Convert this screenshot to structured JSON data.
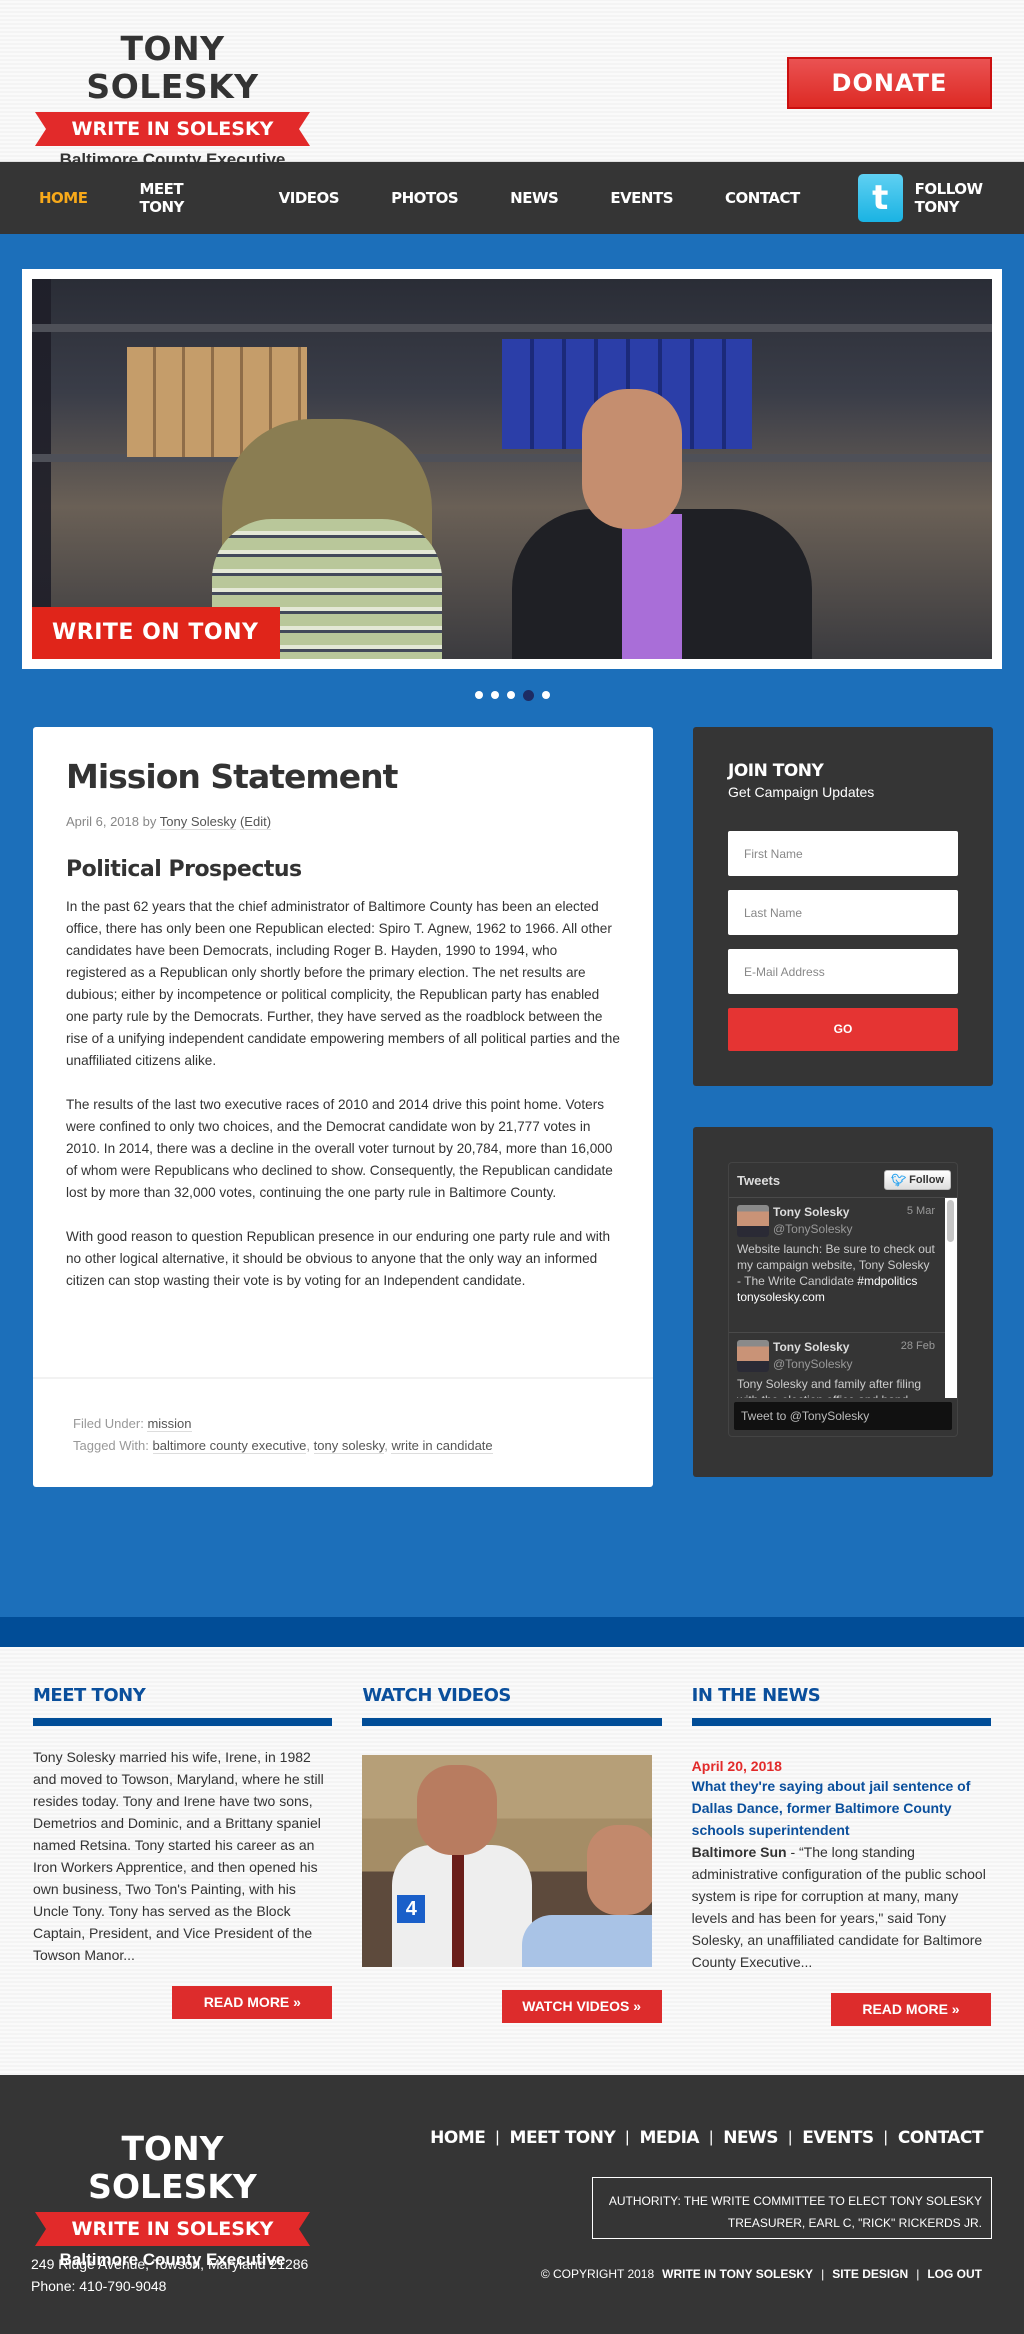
{
  "header": {
    "logo": {
      "name": "TONY SOLESKY",
      "ribbon": "WRITE IN SOLESKY",
      "subtitle": "Baltimore County Executive"
    },
    "donate_label": "DONATE"
  },
  "nav": {
    "items": [
      {
        "label": "HOME",
        "active": true
      },
      {
        "label": "MEET TONY"
      },
      {
        "label": "VIDEOS"
      },
      {
        "label": "PHOTOS"
      },
      {
        "label": "NEWS"
      },
      {
        "label": "EVENTS"
      },
      {
        "label": "CONTACT"
      }
    ],
    "follow_label": "FOLLOW TONY",
    "follow_icon": "twitter-icon"
  },
  "slider": {
    "caption": "WRITE ON TONY",
    "slide_count": 5,
    "active_slide": 4
  },
  "post": {
    "title": "Mission Statement",
    "date": "April 6, 2018",
    "by": "by",
    "author": "Tony Solesky",
    "edit_label": "(Edit)",
    "subheading": "Political Prospectus",
    "paragraphs": [
      "In the past 62 years that the chief administrator of Baltimore County has been an elected office, there has only been one Republican elected: Spiro T. Agnew, 1962 to 1966. All other candidates have been Democrats, including Roger B. Hayden, 1990 to 1994, who registered as a Republican only shortly before the primary election. The net results are dubious; either by incompetence or political complicity, the Republican party has enabled one party rule by the Democrats. Further, they have served as the roadblock between the rise of a unifying independent candidate empowering members of all political parties and the unaffiliated citizens alike.",
      "The results of the last two executive races of 2010 and 2014 drive this point home. Voters were confined to only two choices, and the Democrat candidate won by 21,777 votes in 2010. In 2014, there was a decline in the overall voter turnout by 20,784, more than 16,000 of whom were Republicans who declined to show. Consequently, the Republican candidate lost by more than 32,000 votes, continuing the one party rule in Baltimore County.",
      "With good reason to question Republican presence in our enduring one party rule and with no other logical alternative, it should be obvious to anyone that the only way an informed citizen can stop wasting their vote is by voting for an Independent candidate."
    ],
    "filed_under_label": "Filed Under:",
    "category": "mission",
    "tagged_with_label": "Tagged With:",
    "tags": [
      "baltimore county executive",
      "tony solesky",
      "write in candidate"
    ]
  },
  "join": {
    "title": "JOIN TONY",
    "subtitle": "Get Campaign Updates",
    "first_name_placeholder": "First Name",
    "last_name_placeholder": "Last Name",
    "email_placeholder": "E-Mail Address",
    "go_label": "GO"
  },
  "tweets": {
    "header": "Tweets",
    "follow_label": "Follow",
    "items": [
      {
        "name": "Tony Solesky",
        "handle": "@TonySolesky",
        "date": "5 Mar",
        "text": "Website launch: Be sure to check out my campaign website, Tony Solesky - The Write Candidate",
        "highlight": "#mdpolitics tonysolesky.com"
      },
      {
        "name": "Tony Solesky",
        "handle": "@TonySolesky",
        "date": "28 Feb",
        "text": "Tony Solesky and family after filing with the election office and hand",
        "highlight": ""
      }
    ],
    "tweet_to_label": "Tweet to @TonySolesky"
  },
  "bottom": {
    "meet": {
      "heading": "MEET TONY",
      "text": "Tony Solesky married his wife, Irene, in 1982 and moved to Towson, Maryland, where he still resides today. Tony and Irene have two sons, Demetrios and Dominic, and a Brittany spaniel named Retsina. Tony started his career as an Iron Workers Apprentice, and then opened his own business, Two Ton's Painting, with his Uncle Tony. Tony has served as the Block Captain, President, and Vice President of the Towson Manor...",
      "cta": "READ MORE »"
    },
    "videos": {
      "heading": "WATCH VIDEOS",
      "mic_label": "4",
      "cta": "WATCH VIDEOS »"
    },
    "news": {
      "heading": "IN THE NEWS",
      "date": "April 20, 2018",
      "title": "What they're saying about jail sentence of Dallas Dance, former Baltimore County schools superintendent",
      "source": "Baltimore Sun",
      "excerpt": " - “The long standing administrative configuration of the public school system is ripe for corruption at many, many levels and has been for years,\" said Tony Solesky, an unaffiliated candidate for Baltimore County Executive...",
      "cta": "READ MORE »"
    }
  },
  "footer": {
    "logo": {
      "name": "TONY SOLESKY",
      "ribbon": "WRITE IN SOLESKY",
      "subtitle": "Baltimore County Executive"
    },
    "address": "249 Ridge Avenue, Towson, Maryland 21286",
    "phone": "Phone: 410-790-9048",
    "nav": [
      "HOME",
      "MEET TONY",
      "MEDIA",
      "NEWS",
      "EVENTS",
      "CONTACT"
    ],
    "authority_line1": "AUTHORITY: THE WRITE COMMITTEE TO ELECT TONY SOLESKY",
    "authority_line2": "TREASURER, EARL C, \"RICK\" RICKERDS JR.",
    "copyright": "© COPYRIGHT 2018",
    "links": [
      "WRITE IN TONY SOLESKY",
      "SITE DESIGN",
      "LOG OUT"
    ]
  },
  "colors": {
    "brand_red": "#e22a2a",
    "brand_blue": "#1c6fba",
    "dark_blue": "#014d97",
    "nav_active": "#f7a91a",
    "dark_bg": "#353535"
  }
}
